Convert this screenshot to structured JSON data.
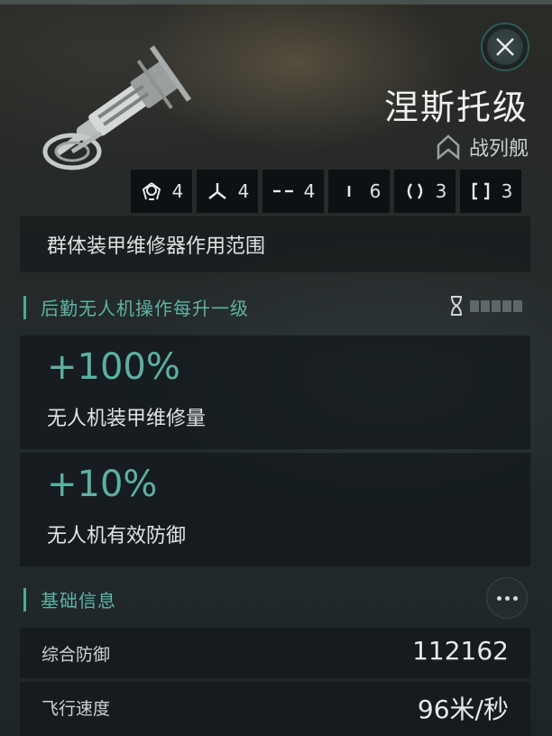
{
  "ship": {
    "name": "涅斯托级",
    "class": "战列舰",
    "slots": [
      {
        "icon": "drone-bay-icon",
        "count": "4"
      },
      {
        "icon": "tri-blade-icon",
        "count": "4"
      },
      {
        "icon": "dash-line-icon",
        "count": "4"
      },
      {
        "icon": "vertical-bar-icon",
        "count": "6"
      },
      {
        "icon": "parentheses-icon",
        "count": "3"
      },
      {
        "icon": "brackets-icon",
        "count": "3"
      }
    ]
  },
  "range_panel": {
    "text": "群体装甲维修器作用范围"
  },
  "skill_section": {
    "title": "后勤无人机操作每升一级",
    "level_pips": 5,
    "bonuses": [
      {
        "value": "+100%",
        "desc": "无人机装甲维修量"
      },
      {
        "value": "+10%",
        "desc": "无人机有效防御"
      }
    ]
  },
  "basic_info": {
    "title": "基础信息",
    "rows": [
      {
        "label": "综合防御",
        "value": "112162"
      },
      {
        "label": "飞行速度",
        "value": "96米/秒"
      }
    ]
  },
  "colors": {
    "accent": "#5fb3a4",
    "panel": "#12181b",
    "close_ring": "#2c5b57"
  }
}
